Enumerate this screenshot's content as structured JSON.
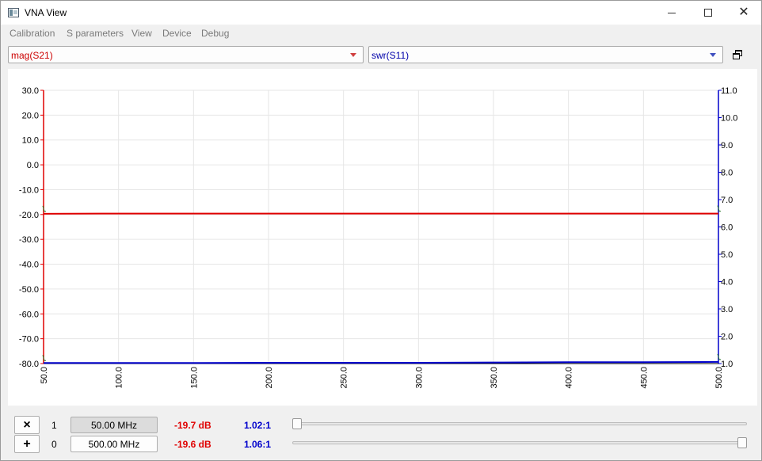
{
  "window": {
    "title": "VNA View"
  },
  "menu": {
    "items": [
      "Calibration",
      "S parameters",
      "View",
      "Device",
      "Debug"
    ]
  },
  "toolbar": {
    "left_trace": "mag(S21)",
    "right_trace": "swr(S11)",
    "float_icon": "float-window-icon"
  },
  "colors": {
    "trace_left": "#e00000",
    "trace_right": "#0000cc",
    "grid": "#e6e6e6"
  },
  "chart_data": {
    "type": "line",
    "title": "",
    "xlabel": "",
    "ylabel": "",
    "x_ticks": [
      "50.0",
      "100.0",
      "150.0",
      "200.0",
      "250.0",
      "300.0",
      "350.0",
      "400.0",
      "450.0",
      "500.0"
    ],
    "xlim": [
      50,
      500
    ],
    "y_left_ticks": [
      "30.0",
      "20.0",
      "10.0",
      "0.0",
      "-10.0",
      "-20.0",
      "-30.0",
      "-40.0",
      "-50.0",
      "-60.0",
      "-70.0",
      "-80.0"
    ],
    "ylim_left": [
      -80,
      30
    ],
    "y_right_ticks": [
      "11.0",
      "10.0",
      "9.0",
      "8.0",
      "7.0",
      "6.0",
      "5.0",
      "4.0",
      "3.0",
      "2.0",
      "1.0"
    ],
    "ylim_right": [
      1,
      11
    ],
    "grid": true,
    "series": [
      {
        "axis": "left",
        "color": "#e00000",
        "x": [
          50,
          100,
          150,
          200,
          250,
          300,
          350,
          400,
          450,
          500
        ],
        "values": [
          -19.7,
          -19.6,
          -19.6,
          -19.6,
          -19.6,
          -19.6,
          -19.6,
          -19.6,
          -19.6,
          -19.6
        ]
      },
      {
        "axis": "right",
        "color": "#0000cc",
        "x": [
          50,
          100,
          150,
          200,
          250,
          300,
          350,
          400,
          450,
          500
        ],
        "values": [
          1.02,
          1.02,
          1.02,
          1.03,
          1.03,
          1.03,
          1.04,
          1.05,
          1.05,
          1.06
        ]
      }
    ]
  },
  "markers": [
    {
      "button": "×",
      "button_icon": "close-icon",
      "index": "1",
      "freq": "50.00 MHz",
      "db": "-19.7 dB",
      "swr": "1.02:1",
      "position": 0.0
    },
    {
      "button": "+",
      "button_icon": "plus-icon",
      "index": "0",
      "freq": "500.00 MHz",
      "db": "-19.6 dB",
      "swr": "1.06:1",
      "position": 1.0
    }
  ]
}
